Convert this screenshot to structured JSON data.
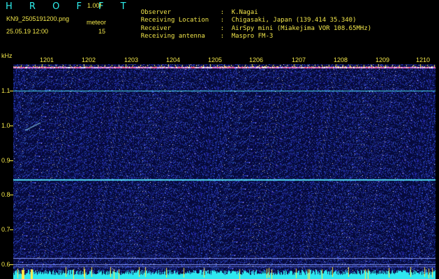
{
  "header": {
    "app_title": "H R O F F T",
    "version": "1.00f",
    "filename": "KN9_2505191200.png",
    "mode": "meteor",
    "datetime": "25.05.19 12:00",
    "count": "15"
  },
  "info": [
    {
      "label": "Observer",
      "value": "K.Nagai"
    },
    {
      "label": "Receiving Location",
      "value": "Chigasaki, Japan (139.414 35.340)"
    },
    {
      "label": "Receiver",
      "value": "AirSpy mini (Miakejima VOR 108.65MHz)"
    },
    {
      "label": "Receiving antenna",
      "value": "Maspro FM-3"
    }
  ],
  "spectrogram": {
    "unit_label": "kHz",
    "x_ticks": [
      "1201",
      "1202",
      "1203",
      "1204",
      "1205",
      "1206",
      "1207",
      "1208",
      "1209",
      "1210"
    ],
    "y_ticks": [
      "1.1",
      "1.0",
      "0.9",
      "0.8",
      "0.7",
      "0.6"
    ],
    "colors": {
      "background": "#060a3c",
      "noise": "#2f47c8",
      "line": "#4fd8f0",
      "text": "#f2e64a",
      "bottom": "#2ee8f0"
    }
  }
}
